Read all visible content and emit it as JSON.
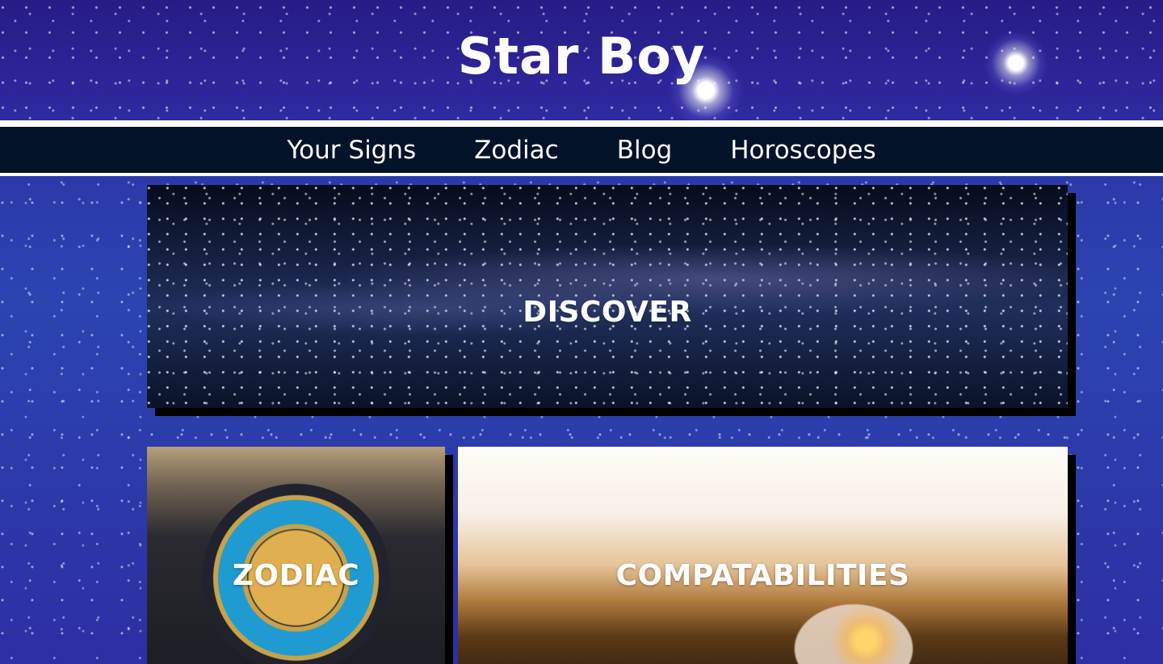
{
  "header": {
    "site_title": "Star Boy"
  },
  "nav": {
    "items": [
      {
        "label": "Your Signs"
      },
      {
        "label": "Zodiac"
      },
      {
        "label": "Blog"
      },
      {
        "label": "Horoscopes"
      }
    ]
  },
  "cards": {
    "discover": {
      "label": "DISCOVER"
    },
    "zodiac": {
      "label": "ZODIAC"
    },
    "compatibilities": {
      "label": "COMPATABILITIES"
    }
  },
  "colors": {
    "nav_background": "#021228",
    "header_background": "#2a1f8a",
    "text": "#ffffff",
    "card_shadow": "#000000"
  }
}
